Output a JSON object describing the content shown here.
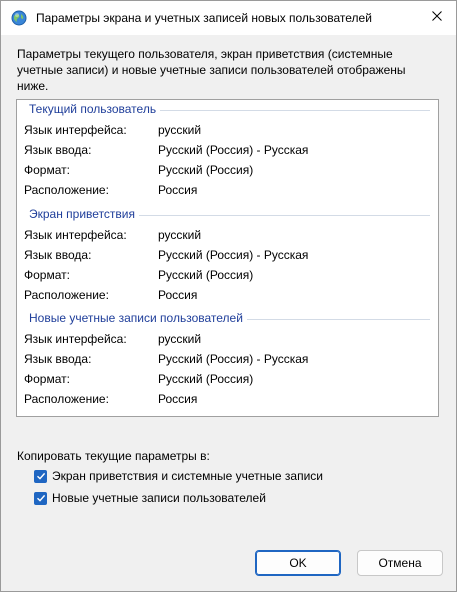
{
  "window": {
    "title": "Параметры экрана и учетных записей новых пользователей",
    "app_icon": "globe-icon",
    "close_icon": "close-icon"
  },
  "intro_text": "Параметры текущего пользователя, экран приветствия (системные учетные записи) и новые учетные записи пользователей отображены ниже.",
  "groups": [
    {
      "title": "Текущий пользователь",
      "rows": [
        {
          "label": "Язык интерфейса:",
          "value": "русский"
        },
        {
          "label": "Язык ввода:",
          "value": "Русский (Россия) - Русская"
        },
        {
          "label": "Формат:",
          "value": "Русский (Россия)"
        },
        {
          "label": "Расположение:",
          "value": "Россия"
        }
      ]
    },
    {
      "title": "Экран приветствия",
      "rows": [
        {
          "label": "Язык интерфейса:",
          "value": "русский"
        },
        {
          "label": "Язык ввода:",
          "value": "Русский (Россия) - Русская"
        },
        {
          "label": "Формат:",
          "value": "Русский (Россия)"
        },
        {
          "label": "Расположение:",
          "value": "Россия"
        }
      ]
    },
    {
      "title": "Новые учетные записи пользователей",
      "rows": [
        {
          "label": "Язык интерфейса:",
          "value": "русский"
        },
        {
          "label": "Язык ввода:",
          "value": "Русский (Россия) - Русская"
        },
        {
          "label": "Формат:",
          "value": "Русский (Россия)"
        },
        {
          "label": "Расположение:",
          "value": "Россия"
        }
      ]
    }
  ],
  "copy": {
    "label": "Копировать текущие параметры в:",
    "options": [
      {
        "label": "Экран приветствия и системные учетные записи",
        "checked": true
      },
      {
        "label": "Новые учетные записи пользователей",
        "checked": true
      }
    ]
  },
  "buttons": {
    "ok": "OK",
    "cancel": "Отмена"
  },
  "colors": {
    "accent": "#1f66c2",
    "group_title": "#1f3e9a"
  }
}
